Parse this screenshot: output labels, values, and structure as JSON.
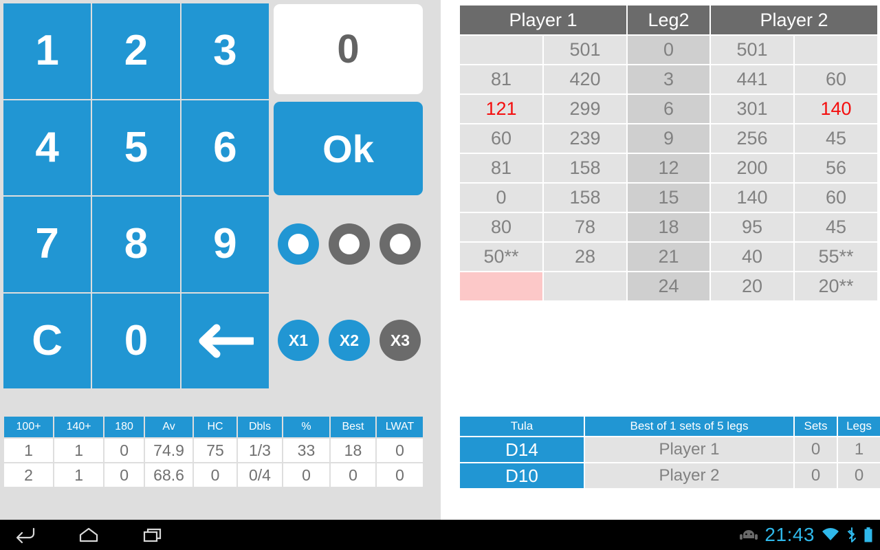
{
  "app": {
    "accent_blue": "#2196d3",
    "panel_gray": "#dedede",
    "cell_gray": "#e3e3e3",
    "leg_col_gray": "#cfcfcf",
    "header_gray": "#6b6b6b",
    "red": "#f40e0e",
    "pink": "#fcc8c8"
  },
  "keypad": {
    "keys": [
      {
        "label": "1",
        "name": "key-1"
      },
      {
        "label": "2",
        "name": "key-2"
      },
      {
        "label": "3",
        "name": "key-3"
      },
      {
        "label": "4",
        "name": "key-4"
      },
      {
        "label": "5",
        "name": "key-5"
      },
      {
        "label": "6",
        "name": "key-6"
      },
      {
        "label": "7",
        "name": "key-7"
      },
      {
        "label": "8",
        "name": "key-8"
      },
      {
        "label": "9",
        "name": "key-9"
      },
      {
        "label": "C",
        "name": "key-clear"
      },
      {
        "label": "0",
        "name": "key-0"
      },
      {
        "label": "",
        "name": "key-backspace",
        "icon": "backspace-arrow-icon"
      }
    ]
  },
  "display": {
    "value": "0"
  },
  "ok_button": {
    "label": "Ok"
  },
  "dart_indicators": {
    "dots": [
      {
        "name": "dart-dot-1",
        "state": "active"
      },
      {
        "name": "dart-dot-2",
        "state": "inactive"
      },
      {
        "name": "dart-dot-3",
        "state": "inactive"
      }
    ]
  },
  "multipliers": {
    "buttons": [
      {
        "label": "X1",
        "name": "multiplier-x1",
        "state": "on"
      },
      {
        "label": "X2",
        "name": "multiplier-x2",
        "state": "on"
      },
      {
        "label": "X3",
        "name": "multiplier-x3",
        "state": "off"
      }
    ]
  },
  "stats": {
    "headers": [
      "100+",
      "140+",
      "180",
      "Av",
      "HC",
      "Dbls",
      "%",
      "Best",
      "LWAT"
    ],
    "rows": [
      [
        "1",
        "1",
        "0",
        "74.9",
        "75",
        "1/3",
        "33",
        "18",
        "0"
      ],
      [
        "2",
        "1",
        "0",
        "68.6",
        "0",
        "0/4",
        "0",
        "0",
        "0"
      ]
    ]
  },
  "score_table": {
    "headers": [
      "Player 1",
      "Leg2",
      "Player 2"
    ],
    "rows": [
      {
        "cells": [
          "",
          "501",
          "0",
          "501",
          ""
        ],
        "styles": [
          "",
          "",
          "legcol",
          "",
          ""
        ]
      },
      {
        "cells": [
          "81",
          "420",
          "3",
          "441",
          "60"
        ],
        "styles": [
          "",
          "",
          "legcol",
          "",
          ""
        ]
      },
      {
        "cells": [
          "121",
          "299",
          "6",
          "301",
          "140"
        ],
        "styles": [
          "red",
          "",
          "legcol",
          "",
          "red"
        ]
      },
      {
        "cells": [
          "60",
          "239",
          "9",
          "256",
          "45"
        ],
        "styles": [
          "",
          "",
          "legcol",
          "",
          ""
        ]
      },
      {
        "cells": [
          "81",
          "158",
          "12",
          "200",
          "56"
        ],
        "styles": [
          "",
          "",
          "legcol",
          "",
          ""
        ]
      },
      {
        "cells": [
          "0",
          "158",
          "15",
          "140",
          "60"
        ],
        "styles": [
          "",
          "",
          "legcol",
          "",
          ""
        ]
      },
      {
        "cells": [
          "80",
          "78",
          "18",
          "95",
          "45"
        ],
        "styles": [
          "",
          "",
          "legcol",
          "",
          ""
        ]
      },
      {
        "cells": [
          "50**",
          "28",
          "21",
          "40",
          "55**"
        ],
        "styles": [
          "",
          "",
          "legcol",
          "",
          ""
        ]
      },
      {
        "cells": [
          "",
          "",
          "24",
          "20",
          "20**"
        ],
        "styles": [
          "pink",
          "",
          "legcol",
          "",
          ""
        ]
      }
    ]
  },
  "match": {
    "headers": [
      "Tula",
      "Best of 1 sets of 5 legs",
      "Sets",
      "Legs"
    ],
    "rows": [
      {
        "checkout": "D14",
        "player": "Player 1",
        "sets": "0",
        "legs": "1",
        "active": true
      },
      {
        "checkout": "D10",
        "player": "Player 2",
        "sets": "0",
        "legs": "0",
        "active": false
      }
    ]
  },
  "navbar": {
    "back": "back-icon",
    "home": "home-icon",
    "recents": "recents-icon",
    "clock": "21:43",
    "icons": [
      "android-robot-icon",
      "wifi-icon",
      "bluetooth-icon",
      "battery-icon"
    ]
  }
}
